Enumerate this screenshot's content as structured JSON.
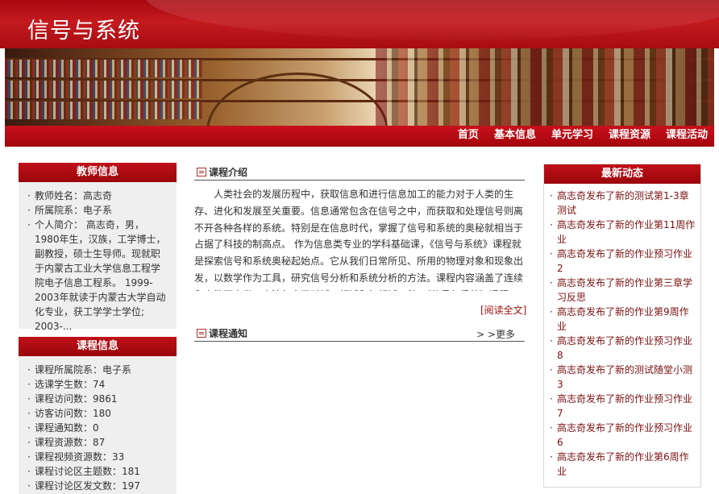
{
  "site": {
    "title": "信号与系统"
  },
  "nav": {
    "items": [
      {
        "label": "首页"
      },
      {
        "label": "基本信息"
      },
      {
        "label": "单元学习"
      },
      {
        "label": "课程资源"
      },
      {
        "label": "课程活动"
      }
    ]
  },
  "teacher": {
    "title": "教师信息",
    "items": [
      "教师姓名：高志奇",
      "所属院系：电子系",
      "个人简介： 高志奇，男，1980年生，汉族，工学博士，副教授，硕士生导师。现就职于内蒙古工业大学信息工程学院电子信息工程系。 1999-2003年就读于内蒙古大学自动化专业，获工学学士学位; 2003-..."
    ]
  },
  "course": {
    "title": "课程信息",
    "items": [
      "课程所属院系：电子系",
      "选课学生数：74",
      "课程访问数：9861",
      "访客访问数：180",
      "课程通知数：0",
      "课程资源数：87",
      "课程视频资源数：33",
      "课程讨论区主题数：181",
      "课程讨论区发文数：197"
    ]
  },
  "intro": {
    "title": "课程介绍",
    "text": "人类社会的发展历程中，获取信息和进行信息加工的能力对于人类的生存、进化和发展至关重要。信息通常包含在信号之中，而获取和处理信号则离不开各种各样的系统。特别是在信息时代，掌握了信号和系统的奥秘就相当于占据了科技的制高点。 作为信息类专业的学科基础课，《信号与系统》课程就是探索信号和系统奥秘起始点。它从我们日常所见、所用的物理对象和现象出发，以数学作为工具，研究信号分析和系统分析的方法。课程内容涵盖了连续和离散两大类，方法包含了时域、频域和复频域三种。《信号与系统》课程",
    "read_more": "[阅读全文]"
  },
  "notice": {
    "title": "课程通知",
    "more": "> >更多"
  },
  "news": {
    "title": "最新动态",
    "items": [
      {
        "who": "高志奇发布了新的测试",
        "what": "第1-3章测试"
      },
      {
        "who": "高志奇发布了新的作业",
        "what": "第11周作业"
      },
      {
        "who": "高志奇发布了新的作业",
        "what": "预习作业2"
      },
      {
        "who": "高志奇发布了新的作业",
        "what": "第三章学习反思"
      },
      {
        "who": "高志奇发布了新的作业",
        "what": "第9周作业"
      },
      {
        "who": "高志奇发布了新的作业",
        "what": "预习作业8"
      },
      {
        "who": "高志奇发布了新的测试",
        "what": "随堂小测3"
      },
      {
        "who": "高志奇发布了新的作业",
        "what": "预习作业7"
      },
      {
        "who": "高志奇发布了新的作业",
        "what": "预习作业6"
      },
      {
        "who": "高志奇发布了新的作业",
        "what": "第6周作业"
      }
    ]
  }
}
